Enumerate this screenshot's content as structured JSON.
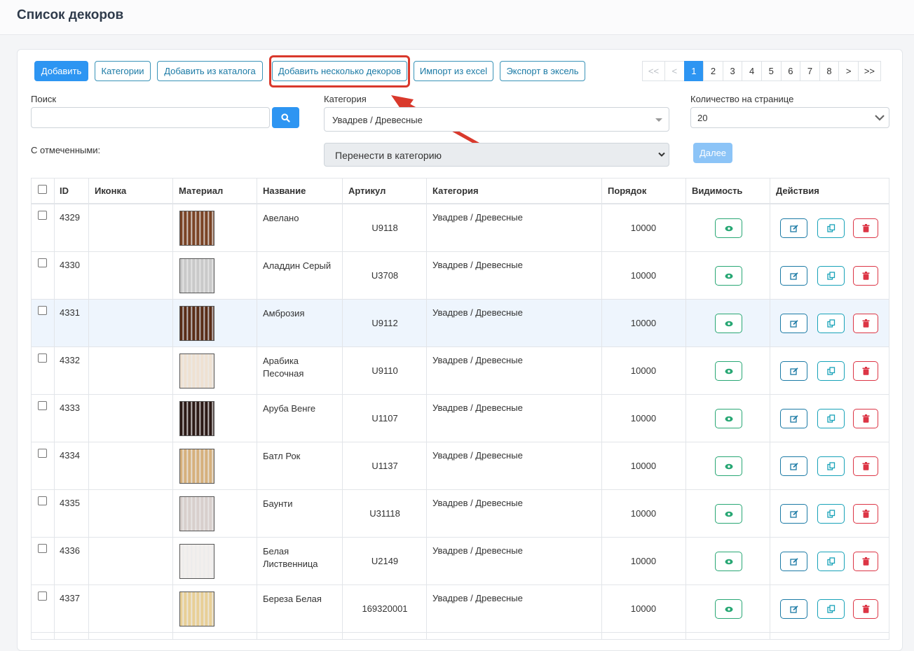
{
  "page_title": "Список декоров",
  "toolbar": {
    "add": "Добавить",
    "categories": "Категории",
    "add_from_catalog": "Добавить из каталога",
    "add_multiple": "Добавить несколько декоров",
    "import_excel": "Импорт из excel",
    "export_excel": "Экспорт в эксель"
  },
  "pagination": {
    "first": "<<",
    "prev": "<",
    "pages": [
      "1",
      "2",
      "3",
      "4",
      "5",
      "6",
      "7",
      "8"
    ],
    "current": "1",
    "next": ">",
    "last": ">>"
  },
  "filters": {
    "search_label": "Поиск",
    "search_value": "",
    "category_label": "Категория",
    "category_value": "Увадрев / Древесные",
    "per_page_label": "Количество на странице",
    "per_page_value": "20",
    "with_selected_label": "С отмеченными:",
    "bulk_action": "Перенести в категорию",
    "next_button": "Далее"
  },
  "table": {
    "headers": {
      "id": "ID",
      "icon": "Иконка",
      "material": "Материал",
      "name": "Название",
      "sku": "Артикул",
      "category": "Категория",
      "order": "Порядок",
      "visibility": "Видимость",
      "actions": "Действия"
    },
    "rows": [
      {
        "id": "4329",
        "name": "Авелано",
        "sku": "U9118",
        "category": "Увадрев / Древесные",
        "order": "10000",
        "swatch_color": "#7a4325"
      },
      {
        "id": "4330",
        "name": "Аладдин Серый",
        "sku": "U3708",
        "category": "Увадрев / Древесные",
        "order": "10000",
        "swatch_color": "#c9c9c9"
      },
      {
        "id": "4331",
        "name": "Амброзия",
        "sku": "U9112",
        "category": "Увадрев / Древесные",
        "order": "10000",
        "swatch_color": "#5a2d17"
      },
      {
        "id": "4332",
        "name": "Арабика Песочная",
        "sku": "U9110",
        "category": "Увадрев / Древесные",
        "order": "10000",
        "swatch_color": "#efe1d2"
      },
      {
        "id": "4333",
        "name": "Аруба Венге",
        "sku": "U1107",
        "category": "Увадрев / Древесные",
        "order": "10000",
        "swatch_color": "#2c1a16"
      },
      {
        "id": "4334",
        "name": "Батл Рок",
        "sku": "U1137",
        "category": "Увадрев / Древесные",
        "order": "10000",
        "swatch_color": "#d6b07c"
      },
      {
        "id": "4335",
        "name": "Баунти",
        "sku": "U31118",
        "category": "Увадрев / Древесные",
        "order": "10000",
        "swatch_color": "#d8cfcc"
      },
      {
        "id": "4336",
        "name": "Белая Лиственница",
        "sku": "U2149",
        "category": "Увадрев / Древесные",
        "order": "10000",
        "swatch_color": "#f2efed"
      },
      {
        "id": "4337",
        "name": "Береза Белая",
        "sku": "169320001",
        "category": "Увадрев / Древесные",
        "order": "10000",
        "swatch_color": "#e8cf96"
      }
    ]
  },
  "colors": {
    "primary": "#2d95f2",
    "outline": "#1b7aa5",
    "success": "#28a774",
    "danger": "#dc3545",
    "annotation": "#d9392c"
  },
  "icons": [
    "search-icon",
    "chevron-down-icon",
    "eye-icon",
    "edit-icon",
    "copy-icon",
    "trash-icon",
    "annotation-arrow"
  ]
}
